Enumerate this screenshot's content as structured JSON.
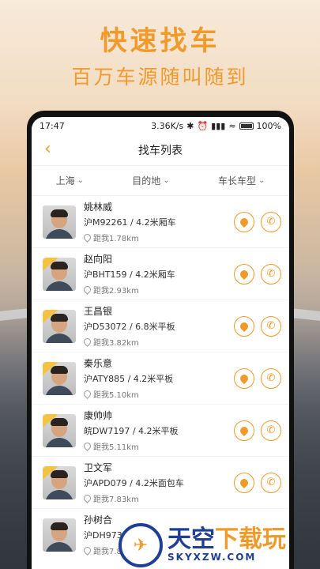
{
  "hero": {
    "title": "快速找车",
    "subtitle": "百万车源随叫随到"
  },
  "status": {
    "time": "17:47",
    "speed": "3.36K/s",
    "battery": "100%"
  },
  "nav": {
    "title": "找车列表",
    "back_icon": "‹"
  },
  "filters": [
    {
      "label": "上海"
    },
    {
      "label": "目的地"
    },
    {
      "label": "车长车型"
    }
  ],
  "drivers": [
    {
      "name": "姚林威",
      "vehicle": "沪M92261 / 4.2米厢车",
      "distance": "距我1.78km"
    },
    {
      "name": "赵向阳",
      "vehicle": "沪BHT159 / 4.2米厢车",
      "distance": "距我2.93km"
    },
    {
      "name": "王昌银",
      "vehicle": "沪D53072 / 6.8米平板",
      "distance": "距我3.82km"
    },
    {
      "name": "秦乐意",
      "vehicle": "沪ATY885 / 4.2米平板",
      "distance": "距我5.10km"
    },
    {
      "name": "康帅帅",
      "vehicle": "皖DW7197 / 4.2米平板",
      "distance": "距我5.11km"
    },
    {
      "name": "卫文军",
      "vehicle": "沪APD079 / 4.2米面包车",
      "distance": "距我7.83km"
    },
    {
      "name": "孙树合",
      "vehicle": "沪DH9730",
      "distance": "距我7.8"
    }
  ],
  "watermark": {
    "name_a": "天空",
    "name_b": "下载玩",
    "url": "SKYXZW.COM"
  },
  "colors": {
    "accent": "#f09a2b",
    "brand_blue": "#1f3f97"
  }
}
